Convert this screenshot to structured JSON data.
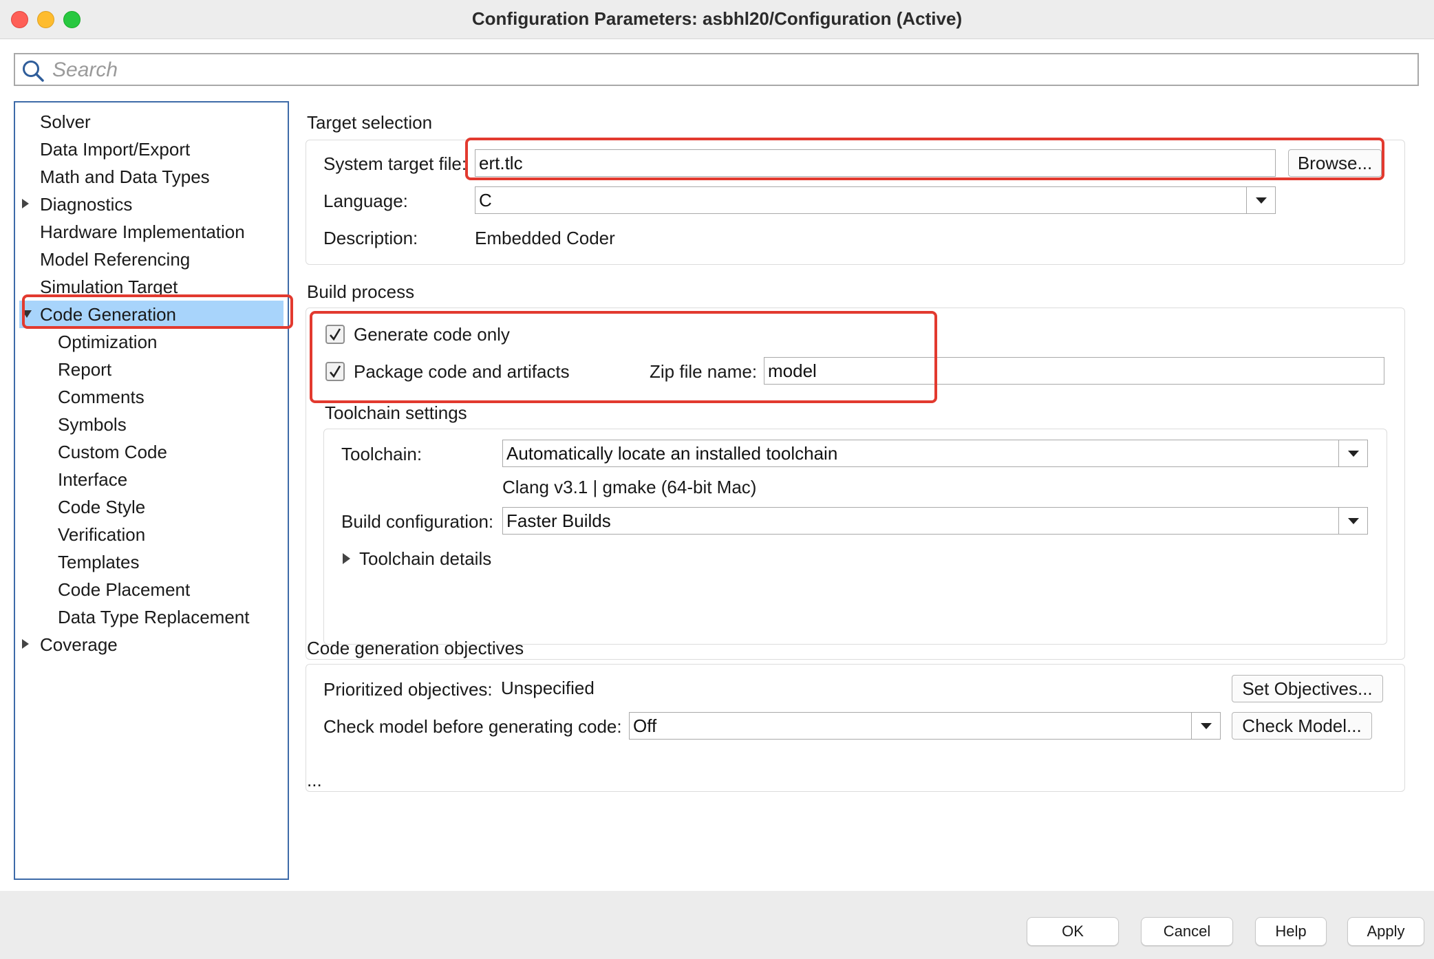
{
  "window": {
    "title": "Configuration Parameters: asbhl20/Configuration (Active)"
  },
  "search": {
    "placeholder": "Search",
    "value": ""
  },
  "sidebar": {
    "items": [
      {
        "label": "Solver"
      },
      {
        "label": "Data Import/Export"
      },
      {
        "label": "Math and Data Types"
      },
      {
        "label": "Diagnostics",
        "expandable": true,
        "expanded": false
      },
      {
        "label": "Hardware Implementation"
      },
      {
        "label": "Model Referencing"
      },
      {
        "label": "Simulation Target"
      },
      {
        "label": "Code Generation",
        "expandable": true,
        "expanded": true,
        "selected": true
      },
      {
        "label": "Optimization"
      },
      {
        "label": "Report"
      },
      {
        "label": "Comments"
      },
      {
        "label": "Symbols"
      },
      {
        "label": "Custom Code"
      },
      {
        "label": "Interface"
      },
      {
        "label": "Code Style"
      },
      {
        "label": "Verification"
      },
      {
        "label": "Templates"
      },
      {
        "label": "Code Placement"
      },
      {
        "label": "Data Type Replacement"
      },
      {
        "label": "Coverage",
        "expandable": true,
        "expanded": false
      }
    ]
  },
  "target_selection": {
    "heading": "Target selection",
    "system_target_file_label": "System target file:",
    "system_target_file_value": "ert.tlc",
    "browse_label": "Browse...",
    "language_label": "Language:",
    "language_value": "C",
    "description_label": "Description:",
    "description_value": "Embedded Coder"
  },
  "build_process": {
    "heading": "Build process",
    "generate_code_only_label": "Generate code only",
    "generate_code_only_checked": true,
    "package_code_label": "Package code and artifacts",
    "package_code_checked": true,
    "zip_file_name_label": "Zip file name:",
    "zip_file_name_value": "model",
    "toolchain_settings": {
      "heading": "Toolchain settings",
      "toolchain_label": "Toolchain:",
      "toolchain_value": "Automatically locate an installed toolchain",
      "toolchain_info": "Clang v3.1 | gmake (64-bit Mac)",
      "build_configuration_label": "Build configuration:",
      "build_configuration_value": "Faster Builds",
      "toolchain_details_label": "Toolchain details"
    }
  },
  "code_generation_objectives": {
    "heading": "Code generation objectives",
    "prioritized_objectives_label": "Prioritized objectives:",
    "prioritized_objectives_value": "Unspecified",
    "set_objectives_label": "Set Objectives...",
    "check_model_label": "Check model before generating code:",
    "check_model_value": "Off",
    "check_model_button_label": "Check Model..."
  },
  "ellipsis": "...",
  "footer": {
    "ok_label": "OK",
    "cancel_label": "Cancel",
    "help_label": "Help",
    "apply_label": "Apply"
  },
  "colors": {
    "selection": "#a8d4fb",
    "highlight": "#e23a2f",
    "sidebar_border": "#3d6aa8"
  }
}
